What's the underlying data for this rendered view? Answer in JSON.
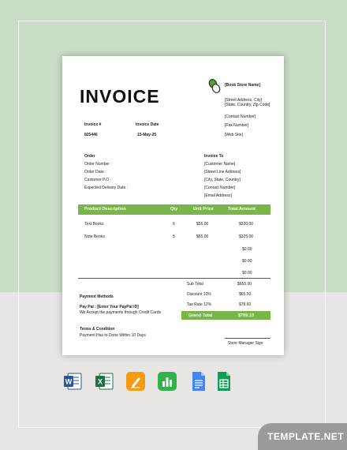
{
  "invoice": {
    "title": "INVOICE",
    "store_name": "[Book Store Name]",
    "street": "[Street Address, City]",
    "state": "[State, Country, Zip Code]",
    "contact": "[Contact Number]",
    "fax": "[Fax Number]",
    "web": "[Web Site]",
    "invoice_no_label": "Invoice #",
    "invoice_no": "825446",
    "invoice_date_label": "Invoice Date",
    "invoice_date": "15-May-25",
    "order_heading": "Order",
    "order_fields": [
      "Order Number :",
      "Order Date :",
      "Customer P.O :",
      "Expected Delivery Date :"
    ],
    "invoice_to_heading": "Invoice To",
    "invoice_to": [
      "[Customer Name]",
      "[Street Line Address]",
      "[City, State, Country]",
      "[Contact Number]",
      "[Email Address]"
    ],
    "columns": [
      "Product Description",
      "Qty",
      "Unit Price",
      "Total Amount"
    ],
    "rows": [
      {
        "desc": "Text Books",
        "qty": "6",
        "unit": "$55.00",
        "total": "$330.00"
      },
      {
        "desc": "Note Books",
        "qty": "5",
        "unit": "$65.00",
        "total": "$325.00"
      },
      {
        "desc": "",
        "qty": "",
        "unit": "",
        "total": "$0.00"
      },
      {
        "desc": "",
        "qty": "",
        "unit": "",
        "total": "$0.00"
      },
      {
        "desc": "",
        "qty": "",
        "unit": "",
        "total": "$0.00"
      }
    ],
    "subtotal_label": "Sub Total",
    "subtotal": "$655.00",
    "discount_label": "Discount 10%",
    "discount": "$65.50",
    "tax_label": "Tax Rate 12%",
    "tax": "$78.60",
    "grand_label": "Grand Total",
    "grand": "$799.10",
    "payment_heading": "Payment Methods",
    "paypal": "Pay Pal : [Enter Your PayPal ID]",
    "credit": "We Accept the payments through Credit Cards",
    "terms_heading": "Terms & Condition",
    "terms": "Payment Has to Done  Within 10 Days",
    "signature": "Store Manager Sign"
  },
  "apps": [
    {
      "name": "word-icon",
      "letter": "W",
      "color": "#2b5797"
    },
    {
      "name": "excel-icon",
      "letter": "X",
      "color": "#1e7145"
    },
    {
      "name": "pages-icon",
      "letter": "",
      "color": "#f39c12"
    },
    {
      "name": "numbers-icon",
      "letter": "",
      "color": "#33b249"
    },
    {
      "name": "google-docs-icon",
      "letter": "",
      "color": "#4285f4"
    },
    {
      "name": "google-sheets-icon",
      "letter": "",
      "color": "#0f9d58"
    }
  ],
  "brand": "TEMPLATE.NET",
  "colors": {
    "accent": "#7ab54a",
    "bg_top": "#c9dcc6",
    "bg_bottom": "#e7e6e4"
  }
}
